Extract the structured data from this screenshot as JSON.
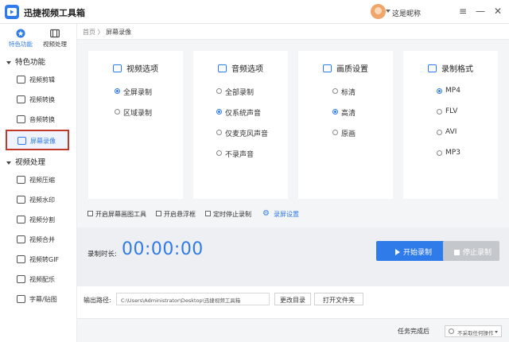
{
  "app": {
    "title": "迅捷视频工具箱"
  },
  "user": {
    "name": "这是昵称"
  },
  "window": {
    "menu_icon": "menu-icon",
    "minimize_icon": "minimize-icon",
    "close_icon": "close-icon"
  },
  "sidebar": {
    "top_tabs": [
      {
        "label": "特色功能",
        "active": true,
        "icon": "star-circle-icon"
      },
      {
        "label": "视频处理",
        "active": false,
        "icon": "film-icon"
      }
    ],
    "groups": [
      {
        "label": "特色功能",
        "items": [
          {
            "label": "视频剪辑",
            "icon": "video-edit-icon"
          },
          {
            "label": "视频转换",
            "icon": "video-convert-icon"
          },
          {
            "label": "音频转换",
            "icon": "audio-convert-icon"
          },
          {
            "label": "屏幕录像",
            "icon": "screen-record-icon",
            "active": true
          }
        ]
      },
      {
        "label": "视频处理",
        "items": [
          {
            "label": "视频压缩",
            "icon": "compress-icon"
          },
          {
            "label": "视频水印",
            "icon": "watermark-icon"
          },
          {
            "label": "视频分割",
            "icon": "split-icon"
          },
          {
            "label": "视频合并",
            "icon": "merge-icon"
          },
          {
            "label": "视频转GIF",
            "icon": "gif-icon"
          },
          {
            "label": "视频配乐",
            "icon": "music-icon"
          },
          {
            "label": "字幕/贴图",
            "icon": "subtitle-icon"
          }
        ]
      }
    ]
  },
  "breadcrumb": {
    "home": "首页",
    "separator": "〉",
    "current": "屏幕录像"
  },
  "cards": [
    {
      "title": "视频选项",
      "icon": "video-option-icon",
      "options": [
        {
          "label": "全屏录制",
          "selected": true
        },
        {
          "label": "区域录制",
          "selected": false
        }
      ]
    },
    {
      "title": "音频选项",
      "icon": "audio-option-icon",
      "options": [
        {
          "label": "全部录制",
          "selected": false
        },
        {
          "label": "仅系统声音",
          "selected": true
        },
        {
          "label": "仅麦克风声音",
          "selected": false
        },
        {
          "label": "不录声音",
          "selected": false
        }
      ]
    },
    {
      "title": "画质设置",
      "icon": "hd-icon",
      "options": [
        {
          "label": "标清",
          "selected": false
        },
        {
          "label": "高清",
          "selected": true
        },
        {
          "label": "原画",
          "selected": false
        }
      ]
    },
    {
      "title": "录制格式",
      "icon": "layers-icon",
      "options": [
        {
          "label": "MP4",
          "selected": true
        },
        {
          "label": "FLV",
          "selected": false
        },
        {
          "label": "AVI",
          "selected": false
        },
        {
          "label": "MP3",
          "selected": false
        }
      ]
    }
  ],
  "toggles": [
    {
      "label": "开启屏幕画图工具",
      "checked": false
    },
    {
      "label": "开启悬浮框",
      "checked": false
    },
    {
      "label": "定时停止录制",
      "checked": false
    }
  ],
  "record_settings_link": "录屏设置",
  "record": {
    "time_label": "录制时长:",
    "time": "00:00:00",
    "start_label": "开始录制",
    "stop_label": "停止录制"
  },
  "output": {
    "label": "输出路径:",
    "path": "C:\\Users\\Administrator\\Desktop\\迅捷视频工具箱",
    "change_label": "更改目录",
    "open_label": "打开文件夹"
  },
  "status": {
    "label": "任务完成后",
    "select_value": "不采取任何操作"
  },
  "colors": {
    "accent": "#2f7bea",
    "highlight_border": "#c0392b",
    "stop_button": "#c4c7cc"
  }
}
